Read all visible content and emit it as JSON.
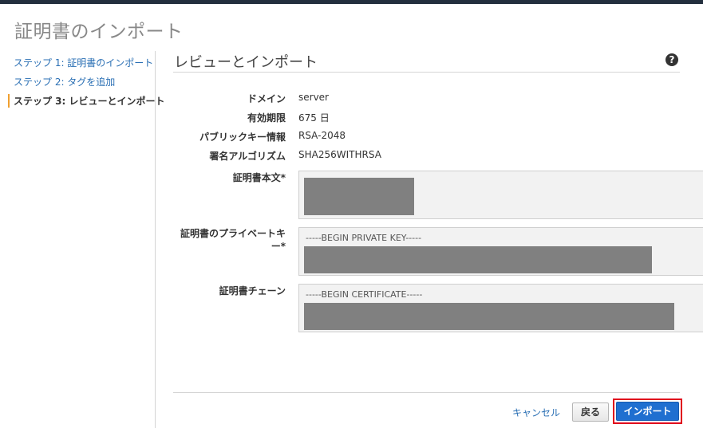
{
  "page": {
    "title": "証明書のインポート"
  },
  "sidebar": {
    "steps": [
      {
        "label": "ステップ 1: 証明書のインポート",
        "state": "link"
      },
      {
        "label": "ステップ 2: タグを追加",
        "state": "link"
      },
      {
        "label": "ステップ 3: レビューとインポート",
        "state": "active"
      }
    ]
  },
  "main": {
    "section_title": "レビューとインポート",
    "help_icon": "?",
    "fields": [
      {
        "label": "ドメイン",
        "value": "server"
      },
      {
        "label": "有効期限",
        "value": "675 日"
      },
      {
        "label": "パブリックキー情報",
        "value": "RSA-2048"
      },
      {
        "label": "署名アルゴリズム",
        "value": "SHA256WITHRSA"
      }
    ],
    "cert_body": {
      "label": "証明書本文*",
      "text": ""
    },
    "private_key": {
      "label": "証明書のプライベートキー*",
      "text": "-----BEGIN PRIVATE KEY-----"
    },
    "chain": {
      "label": "証明書チェーン",
      "text": "-----BEGIN CERTIFICATE-----"
    }
  },
  "footer": {
    "cancel_label": "キャンセル",
    "back_label": "戻る",
    "import_label": "インポート"
  },
  "colors": {
    "accent": "#1f6fd0",
    "link": "#2a6fb4",
    "active_step_bar": "#f0a030",
    "highlight_border": "#e0001b",
    "redaction": "#808080"
  }
}
